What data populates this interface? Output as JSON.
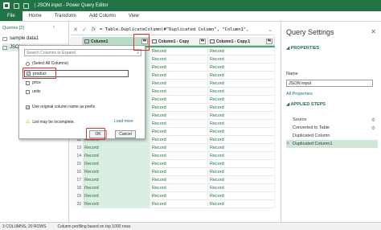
{
  "window": {
    "title": "| JSON input - Power Query Editor"
  },
  "ribbon": {
    "tabs": [
      "File",
      "Home",
      "Transform",
      "Add Column",
      "View"
    ]
  },
  "queries_pane": {
    "header": "Queries [2]",
    "items": [
      "sample data1",
      "JSON input"
    ]
  },
  "formula_bar": {
    "fx": "fx",
    "text": "= Table.DuplicateColumn(#\"Duplicated Column\", \"Column1\","
  },
  "grid": {
    "columns": [
      "Column1",
      "Column1 - Copy",
      "Column1 - Copy.1"
    ],
    "cell_value": "Record",
    "row_numbers": [
      "1",
      "2",
      "3",
      "4",
      "5",
      "6",
      "7",
      "8",
      "9",
      "10",
      "11",
      "12",
      "13",
      "14",
      "15",
      "16",
      "17",
      "18",
      "19",
      "20"
    ]
  },
  "expand_popup": {
    "search_placeholder": "Search Columns to Expand",
    "select_all": "(Select All Columns)",
    "options": [
      {
        "label": "product",
        "checked": true
      },
      {
        "label": "price",
        "checked": false
      },
      {
        "label": "units",
        "checked": false
      }
    ],
    "prefix_label": "Use original column name as prefix",
    "prefix_checked": true,
    "warning": "List may be incomplete.",
    "load_more": "Load more",
    "ok": "OK",
    "cancel": "Cancel"
  },
  "query_settings": {
    "title": "Query Settings",
    "properties_header": "PROPERTIES",
    "name_label": "Name",
    "name_value": "JSON input",
    "all_properties": "All Properties",
    "applied_steps_header": "APPLIED STEPS",
    "steps": [
      "Source",
      "Converted to Table",
      "Duplicated Column",
      "Duplicated Column1"
    ]
  },
  "status_bar": {
    "columns_rows": "3 COLUMNS, 20 ROWS",
    "profiling": "Column profiling based on top 1000 rows"
  },
  "colors": {
    "accent": "#217346",
    "highlight": "#e03030",
    "record": "#1b6e3c"
  }
}
